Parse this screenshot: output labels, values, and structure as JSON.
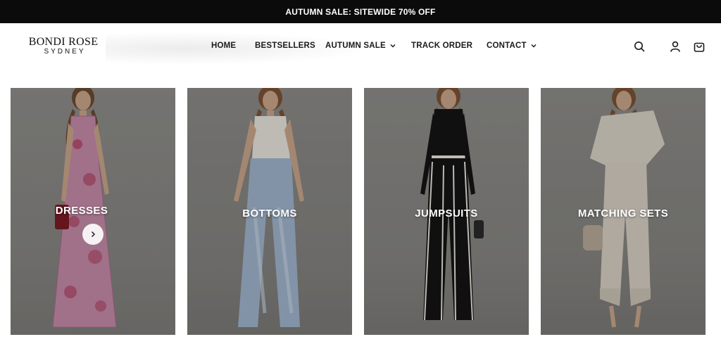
{
  "announcement": {
    "text": "AUTUMN SALE: SITEWIDE 70% OFF"
  },
  "brand": {
    "line1": "BONDI ROSE",
    "line2": "SYDNEY"
  },
  "nav": {
    "items": [
      {
        "label": "HOME",
        "has_dropdown": false
      },
      {
        "label": "BESTSELLERS",
        "has_dropdown": false
      },
      {
        "label": "AUTUMN SALE",
        "has_dropdown": true
      },
      {
        "label": "TRACK ORDER",
        "has_dropdown": false
      },
      {
        "label": "CONTACT",
        "has_dropdown": true
      }
    ]
  },
  "header_icons": [
    "search-icon",
    "account-icon",
    "cart-icon"
  ],
  "categories": [
    {
      "label": "DRESSES",
      "icon": "chevron-right-icon"
    },
    {
      "label": "BOTTOMS"
    },
    {
      "label": "JUMPSUITS"
    },
    {
      "label": "MATCHING SETS"
    }
  ],
  "colors": {
    "announcement_bg": "#0b0b0b",
    "text_dark": "#1a1a1a",
    "card_bg": "#8a8a88"
  }
}
